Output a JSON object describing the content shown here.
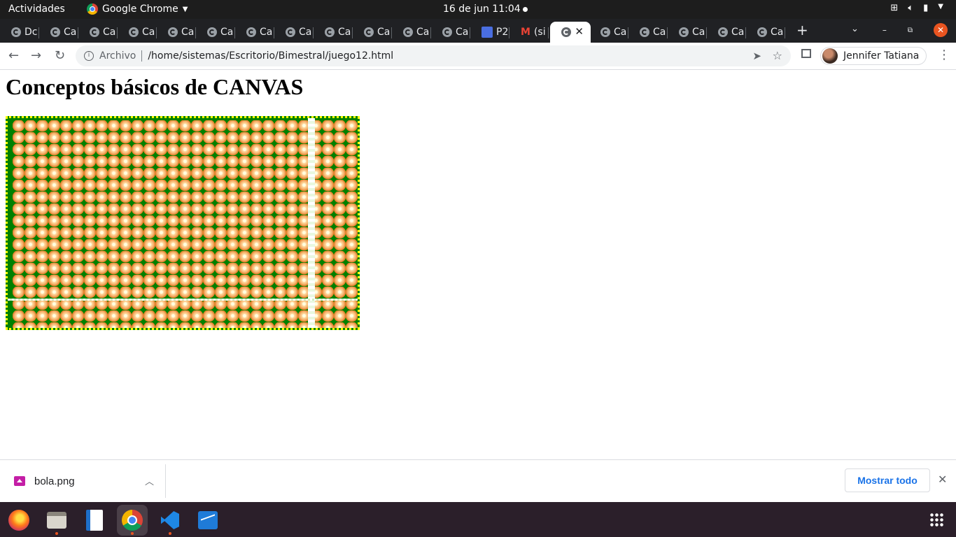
{
  "topbar": {
    "activities": "Actividades",
    "app_name": "Google Chrome",
    "clock": "16 de jun  11:04"
  },
  "tabs": [
    {
      "label": "Dc",
      "icon": "globe-icon"
    },
    {
      "label": "Ca",
      "icon": "globe-icon"
    },
    {
      "label": "Ca",
      "icon": "globe-icon"
    },
    {
      "label": "Ca",
      "icon": "globe-icon"
    },
    {
      "label": "Ca",
      "icon": "globe-icon"
    },
    {
      "label": "Ca",
      "icon": "globe-icon"
    },
    {
      "label": "Ca",
      "icon": "globe-icon"
    },
    {
      "label": "Ca",
      "icon": "globe-icon"
    },
    {
      "label": "Ca",
      "icon": "globe-icon"
    },
    {
      "label": "Ca",
      "icon": "globe-icon"
    },
    {
      "label": "Ca",
      "icon": "globe-icon"
    },
    {
      "label": "Ca",
      "icon": "globe-icon"
    },
    {
      "label": "P2",
      "icon": "classroom-icon"
    },
    {
      "label": "(si",
      "icon": "gmail-icon"
    },
    {
      "label": "",
      "icon": "globe-icon",
      "active": true
    },
    {
      "label": "Ca",
      "icon": "globe-icon"
    },
    {
      "label": "Ca",
      "icon": "globe-icon"
    },
    {
      "label": "Ca",
      "icon": "globe-icon"
    },
    {
      "label": "Ca",
      "icon": "globe-icon"
    },
    {
      "label": "Ca",
      "icon": "globe-icon"
    }
  ],
  "toolbar": {
    "security_label": "Archivo",
    "url": "/home/sistemas/Escritorio/Bimestral/juego12.html",
    "profile_name": "Jennifer Tatiana"
  },
  "page": {
    "title": "Conceptos básicos de CANVAS",
    "canvas": {
      "background_color": "#008000",
      "border_color": "#ffff00",
      "pattern_image": "bola.png"
    }
  },
  "downloads": {
    "file_name": "bola.png",
    "show_all_label": "Mostrar todo"
  },
  "dock": {
    "apps": [
      "firefox-icon",
      "files-icon",
      "writer-icon",
      "chrome-icon",
      "vscode-icon",
      "system-monitor-icon"
    ]
  },
  "colors": {
    "accent": "#1a73e8",
    "ubuntu_orange": "#e95420"
  }
}
